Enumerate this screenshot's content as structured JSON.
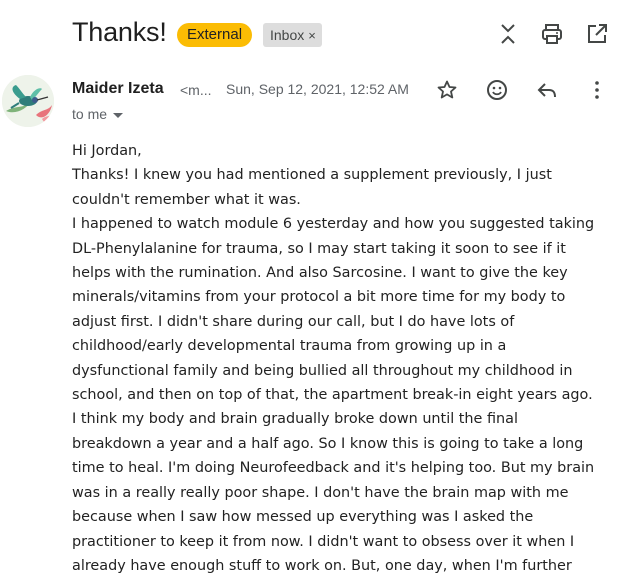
{
  "subject": "Thanks!",
  "labels": {
    "external": "External",
    "inbox": "Inbox",
    "inbox_remove": "×"
  },
  "toolbar": {
    "icons": [
      "expand-collapse-icon",
      "print-icon",
      "open-in-new-window-icon"
    ]
  },
  "message": {
    "sender_name": "Maider Izeta",
    "sender_email_truncated": "<m...",
    "date": "Sun, Sep 12, 2021, 12:52 AM",
    "recipient": "to me",
    "actions": [
      "star-icon",
      "emoji-react-icon",
      "reply-icon",
      "more-vert-icon"
    ],
    "greeting": "Hi Jordan,",
    "lines": [
      "Thanks! I knew you had mentioned a supplement previously, I just",
      "couldn't remember what it was.",
      "I happened to watch module 6 yesterday and how you suggested taking",
      "DL-Phenylalanine for trauma, so I may start taking it soon to see if it",
      "helps with the rumination. And also Sarcosine. I want to give the key",
      "minerals/vitamins from your protocol a bit more time for my body to",
      "adjust first. I didn't share during our call, but I do have lots of",
      "childhood/early developmental trauma from growing up in a",
      "dysfunctional family and being bullied all throughout my childhood in",
      "school, and then on top of that, the apartment break-in eight years ago.",
      "I think my body and brain gradually broke down until the final",
      "breakdown a year and a half ago. So I know this is going to take a long",
      "time to heal. I'm doing Neurofeedback and it's helping too. But my brain",
      "was in a really really poor shape. I don't have the brain map with me",
      "because when I saw how messed up everything was I asked the",
      "practitioner to keep it from now. I didn't want to obsess over it when I",
      "already have enough stuff to work on. But, one day, when I'm further"
    ]
  },
  "colors": {
    "external_badge": "#fbbc04",
    "inbox_badge": "#dddddd",
    "icon": "#444746"
  }
}
